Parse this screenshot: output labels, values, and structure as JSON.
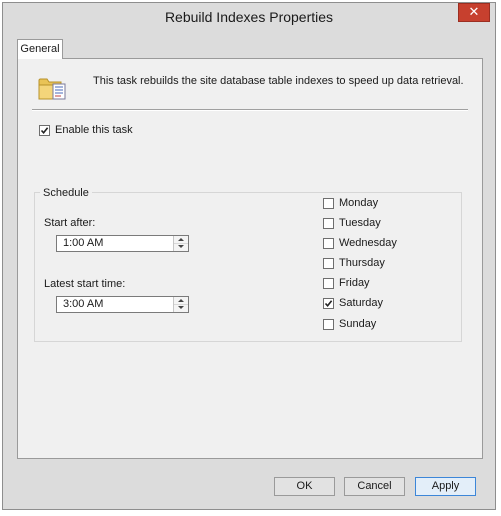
{
  "window": {
    "title": "Rebuild Indexes Properties",
    "close_glyph": "✕"
  },
  "tabs": [
    {
      "label": "General",
      "selected": true
    }
  ],
  "general": {
    "icon": "folder-document-icon",
    "description": "This task rebuilds the site database table indexes to speed up data retrieval.",
    "enable_task": {
      "label": "Enable this task",
      "checked": true
    },
    "schedule": {
      "group_label": "Schedule",
      "start_after": {
        "label": "Start after:",
        "value": "1:00 AM"
      },
      "latest_start": {
        "label": "Latest start time:",
        "value": "3:00 AM"
      },
      "days": [
        {
          "label": "Monday",
          "checked": false
        },
        {
          "label": "Tuesday",
          "checked": false
        },
        {
          "label": "Wednesday",
          "checked": false
        },
        {
          "label": "Thursday",
          "checked": false
        },
        {
          "label": "Friday",
          "checked": false
        },
        {
          "label": "Saturday",
          "checked": true
        },
        {
          "label": "Sunday",
          "checked": false
        }
      ]
    }
  },
  "buttons": {
    "ok": "OK",
    "cancel": "Cancel",
    "apply": "Apply"
  },
  "colors": {
    "close_button": "#c7402e",
    "apply_border": "#3c86d8",
    "window_bg": "#dcdcdc",
    "panel_bg": "#f0f0f0"
  }
}
